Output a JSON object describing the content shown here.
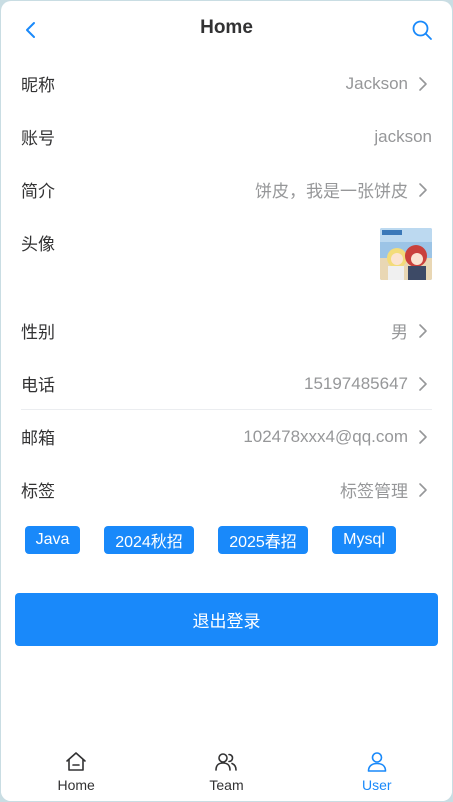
{
  "navbar": {
    "title": "Home",
    "back_icon": "chevron-left-icon",
    "search_icon": "search-icon",
    "accent": "#1989fa"
  },
  "profile": {
    "nickname": {
      "label": "昵称",
      "value": "Jackson"
    },
    "account": {
      "label": "账号",
      "value": "jackson"
    },
    "intro": {
      "label": "简介",
      "value": "饼皮，我是一张饼皮"
    },
    "avatar": {
      "label": "头像"
    },
    "gender": {
      "label": "性别",
      "value": "男"
    },
    "phone": {
      "label": "电话",
      "value": "15197485647"
    },
    "email": {
      "label": "邮箱",
      "value": "102478xxx4@qq.com"
    },
    "tags": {
      "label": "标签",
      "value": "标签管理"
    }
  },
  "tags": [
    "Java",
    "2024秋招",
    "2025春招",
    "Mysql"
  ],
  "logout_label": "退出登录",
  "tabbar": {
    "items": [
      {
        "label": "Home",
        "icon": "home-icon",
        "active": false
      },
      {
        "label": "Team",
        "icon": "team-icon",
        "active": false
      },
      {
        "label": "User",
        "icon": "user-icon",
        "active": true
      }
    ]
  },
  "colors": {
    "primary": "#1989fa",
    "text": "#323233",
    "muted": "#969799",
    "divider": "#ebedf0"
  }
}
